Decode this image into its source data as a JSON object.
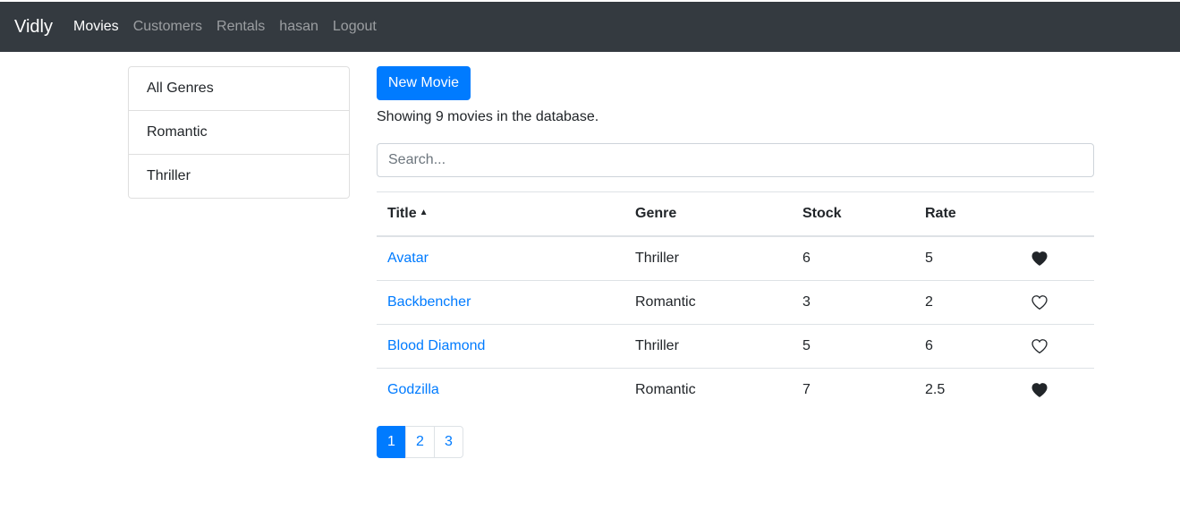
{
  "navbar": {
    "brand": "Vidly",
    "links": [
      "Movies",
      "Customers",
      "Rentals",
      "hasan",
      "Logout"
    ]
  },
  "genres": [
    "All Genres",
    "Romantic",
    "Thriller"
  ],
  "new_movie_label": "New Movie",
  "count_text": "Showing 9 movies in the database.",
  "search": {
    "placeholder": "Search...",
    "value": ""
  },
  "table": {
    "headers": {
      "title": "Title",
      "genre": "Genre",
      "stock": "Stock",
      "rate": "Rate"
    },
    "sort_icon": "caret-up-icon",
    "rows": [
      {
        "title": "Avatar",
        "genre": "Thriller",
        "stock": "6",
        "rate": "5",
        "liked": true
      },
      {
        "title": "Backbencher",
        "genre": "Romantic",
        "stock": "3",
        "rate": "2",
        "liked": false
      },
      {
        "title": "Blood Diamond",
        "genre": "Thriller",
        "stock": "5",
        "rate": "6",
        "liked": false
      },
      {
        "title": "Godzilla",
        "genre": "Romantic",
        "stock": "7",
        "rate": "2.5",
        "liked": true
      }
    ]
  },
  "pagination": {
    "pages": [
      "1",
      "2",
      "3"
    ],
    "current": "1"
  },
  "colors": {
    "navbar_bg": "#343a40",
    "primary": "#007bff",
    "link": "#007bff"
  }
}
